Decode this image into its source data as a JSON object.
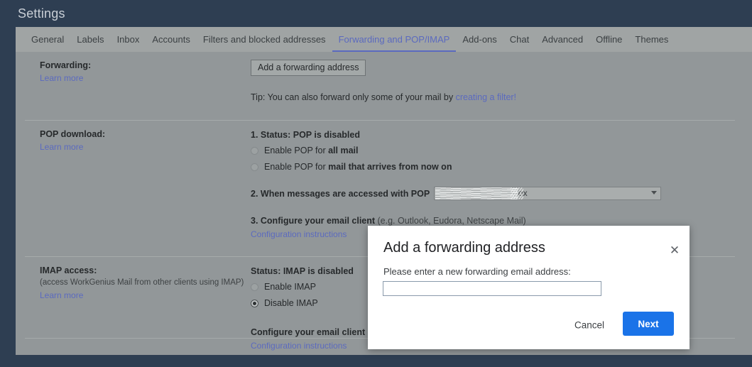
{
  "window": {
    "title": "Settings"
  },
  "tabs": [
    {
      "label": "General",
      "active": false
    },
    {
      "label": "Labels",
      "active": false
    },
    {
      "label": "Inbox",
      "active": false
    },
    {
      "label": "Accounts",
      "active": false
    },
    {
      "label": "Filters and blocked addresses",
      "active": false
    },
    {
      "label": "Forwarding and POP/IMAP",
      "active": true
    },
    {
      "label": "Add-ons",
      "active": false
    },
    {
      "label": "Chat",
      "active": false
    },
    {
      "label": "Advanced",
      "active": false
    },
    {
      "label": "Offline",
      "active": false
    },
    {
      "label": "Themes",
      "active": false
    }
  ],
  "forwarding": {
    "label": "Forwarding:",
    "learn_more": "Learn more",
    "add_button": "Add a forwarding address",
    "tip_prefix": "Tip: You can also forward only some of your mail by ",
    "tip_link": "creating a filter!"
  },
  "pop": {
    "label": "POP download:",
    "learn_more": "Learn more",
    "status": "1. Status: POP is disabled",
    "option_all_prefix": "Enable POP for ",
    "option_all_bold": "all mail",
    "option_new_prefix": "Enable POP for ",
    "option_new_bold": "mail that arrives from now on",
    "option_all_selected": false,
    "option_new_selected": false,
    "step2_label": "2. When messages are accessed with POP",
    "step2_select_value": "Mail's copy in the Inbox",
    "step2_select_redacted": true,
    "step3_bold": "3. Configure your email client",
    "step3_rest": " (e.g. Outlook, Eudora, Netscape Mail)",
    "step3_link": "Configuration instructions"
  },
  "imap": {
    "label": "IMAP access:",
    "note": "(access WorkGenius Mail from other clients using IMAP)",
    "learn_more": "Learn more",
    "status": "Status: IMAP is disabled",
    "option_enable": "Enable IMAP",
    "option_disable": "Disable IMAP",
    "option_enable_selected": false,
    "option_disable_selected": true,
    "configure_bold": "Configure your email client",
    "configure_rest": " (",
    "configure_link": "Configuration instructions"
  },
  "modal": {
    "title": "Add a forwarding address",
    "prompt": "Please enter a new forwarding email address:",
    "input_value": "",
    "input_placeholder": "",
    "cancel_label": "Cancel",
    "next_label": "Next",
    "close_glyph": "✕"
  },
  "colors": {
    "chrome_dark": "#2e3e52",
    "page_gray": "#929799",
    "tabbar_gray": "#a0a4a4",
    "accent_link": "#5b6abf",
    "primary_button": "#1a73e8"
  }
}
